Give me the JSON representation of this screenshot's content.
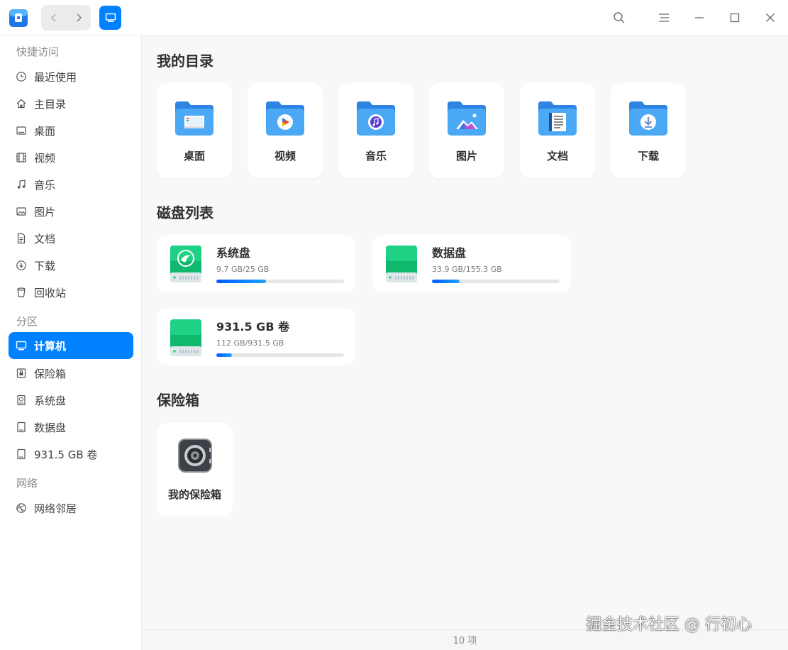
{
  "window": {
    "status_count": "10 项",
    "watermark": "掘金技术社区 @ 行初心"
  },
  "colors": {
    "accent": "#0081ff",
    "folder_top": "#3a8ae8",
    "folder_body": "#4aa8f5",
    "disk_green": "#10b86e",
    "progress": "#1a8cff"
  },
  "titlebar": {
    "icons": [
      "back-icon",
      "forward-icon",
      "computer-icon",
      "search-icon",
      "menu-icon",
      "minimize-icon",
      "maximize-icon",
      "close-icon"
    ]
  },
  "sidebar": {
    "quick_access_label": "快捷访问",
    "partitions_label": "分区",
    "network_label": "网络",
    "quick_items": [
      {
        "label": "最近使用",
        "icon": "clock-icon"
      },
      {
        "label": "主目录",
        "icon": "home-icon"
      },
      {
        "label": "桌面",
        "icon": "desktop-icon"
      },
      {
        "label": "视频",
        "icon": "film-icon"
      },
      {
        "label": "音乐",
        "icon": "music-icon"
      },
      {
        "label": "图片",
        "icon": "image-icon"
      },
      {
        "label": "文档",
        "icon": "document-icon"
      },
      {
        "label": "下载",
        "icon": "download-icon"
      },
      {
        "label": "回收站",
        "icon": "trash-icon"
      }
    ],
    "partition_items": [
      {
        "label": "计算机",
        "icon": "computer-icon",
        "active": true
      },
      {
        "label": "保险箱",
        "icon": "safe-icon"
      },
      {
        "label": "系统盘",
        "icon": "disk-icon"
      },
      {
        "label": "数据盘",
        "icon": "disk-icon"
      },
      {
        "label": "931.5 GB 卷",
        "icon": "disk-icon"
      }
    ],
    "network_items": [
      {
        "label": "网络邻居",
        "icon": "network-icon"
      }
    ]
  },
  "main": {
    "my_dirs_title": "我的目录",
    "dirs": [
      {
        "label": "桌面",
        "icon": "folder-desktop-icon"
      },
      {
        "label": "视频",
        "icon": "folder-video-icon"
      },
      {
        "label": "音乐",
        "icon": "folder-music-icon"
      },
      {
        "label": "图片",
        "icon": "folder-pictures-icon"
      },
      {
        "label": "文档",
        "icon": "folder-documents-icon"
      },
      {
        "label": "下载",
        "icon": "folder-download-icon"
      }
    ],
    "disks_title": "磁盘列表",
    "disks": [
      {
        "name": "系统盘",
        "size": "9.7 GB/25 GB",
        "used_fraction": 0.388,
        "icon": "system-disk-icon"
      },
      {
        "name": "数据盘",
        "size": "33.9 GB/155.3 GB",
        "used_fraction": 0.218,
        "icon": "data-disk-icon"
      },
      {
        "name": "931.5 GB 卷",
        "size": "112 GB/931.5 GB",
        "used_fraction": 0.12,
        "icon": "volume-disk-icon"
      }
    ],
    "safe_title": "保险箱",
    "safe_label": "我的保险箱"
  }
}
